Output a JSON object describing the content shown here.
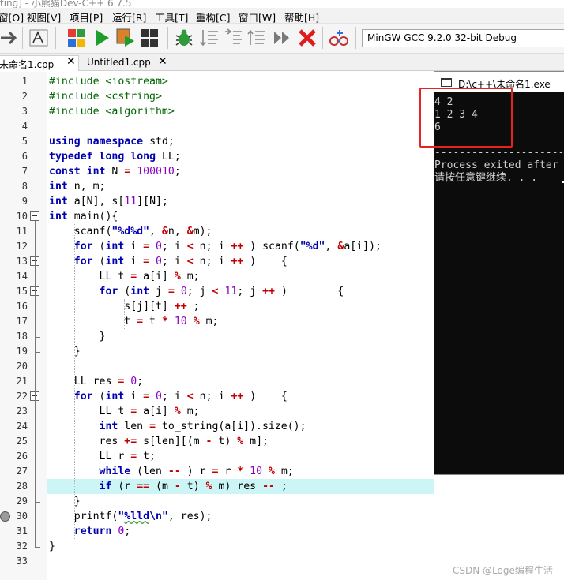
{
  "window": {
    "title_fragment": "ting] - 小熊猫Dev-C++ 6.7.5"
  },
  "menu": [
    "窗[O]",
    "视图[V]",
    "项目[P]",
    "运行[R]",
    "工具[T]",
    "重构[C]",
    "窗口[W]",
    "帮助[H]"
  ],
  "toolbar": {
    "compiler": "MinGW GCC 9.2.0 32-bit Debug"
  },
  "tabs": [
    {
      "label": "未命名1.cpp",
      "active": true
    },
    {
      "label": "Untitled1.cpp",
      "active": false
    }
  ],
  "editor": {
    "highlighted_line": 28,
    "breakpoint_line": 30,
    "line_numbers": [
      "1",
      "2",
      "3",
      "4",
      "5",
      "6",
      "7",
      "8",
      "9",
      "10",
      "11",
      "12",
      "13",
      "14",
      "15",
      "16",
      "17",
      "18",
      "19",
      "20",
      "21",
      "22",
      "23",
      "24",
      "25",
      "26",
      "27",
      "28",
      "29",
      "30",
      "31",
      "32",
      "33"
    ],
    "lines": [
      "#include <iostream>",
      "#include <cstring>",
      "#include <algorithm>",
      "",
      "using namespace std;",
      "typedef long long LL;",
      "const int N = 100010;",
      "int n, m;",
      "int a[N], s[11][N];",
      "int main(){",
      "    scanf(\"%d%d\", &n, &m);",
      "    for (int i = 0; i < n; i ++ ) scanf(\"%d\", &a[i]);",
      "    for (int i = 0; i < n; i ++ )    {",
      "        LL t = a[i] % m;",
      "        for (int j = 0; j < 11; j ++ )        {",
      "            s[j][t] ++ ;",
      "            t = t * 10 % m;",
      "        }",
      "    }",
      "",
      "    LL res = 0;",
      "    for (int i = 0; i < n; i ++ )    {",
      "        LL t = a[i] % m;",
      "        int len = to_string(a[i]).size();",
      "        res += s[len][(m - t) % m];",
      "        LL r = t;",
      "        while (len -- ) r = r * 10 % m;",
      "        if (r == (m - t) % m) res -- ;",
      "    }",
      "    printf(\"%lld\\n\", res);",
      "    return 0;",
      "}",
      ""
    ]
  },
  "console": {
    "title": "D:\\c++\\未命名1.exe",
    "output": [
      "4 2",
      "1 2 3 4",
      "6"
    ],
    "separator": "-------------------------",
    "exit_line": "Process exited after",
    "prompt": "请按任意键继续. . ."
  },
  "watermark": "CSDN @Loge编程生活",
  "colors": {
    "keyword": "#0000b0",
    "number": "#8a00c0",
    "operator": "#c00000",
    "preprocessor": "#006400",
    "highlight_row": "#ccf5f5",
    "annotation_box": "#e8221d"
  }
}
